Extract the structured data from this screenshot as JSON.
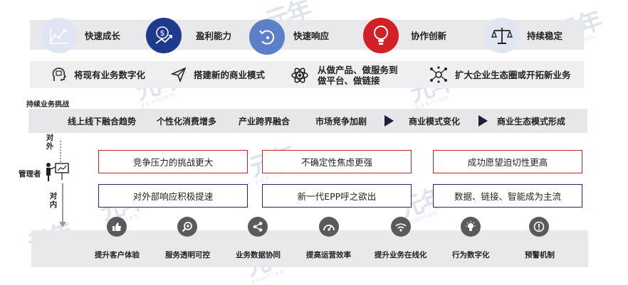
{
  "row1": [
    {
      "label": "快速成长",
      "icon": "growth-chart-icon"
    },
    {
      "label": "盈利能力",
      "icon": "money-growth-icon"
    },
    {
      "label": "快速响应",
      "icon": "refresh-cycle-icon"
    },
    {
      "label": "协作创新",
      "icon": "lightbulb-icon"
    },
    {
      "label": "持续稳定",
      "icon": "balance-scale-icon"
    }
  ],
  "row2": [
    {
      "label": "将现有业务数字化",
      "icon": "brain-head-icon"
    },
    {
      "label": "搭建新的商业模式",
      "icon": "paper-plane-icon"
    },
    {
      "label_line1": "从做产品、做服务到",
      "label_line2": "做平台、做链接",
      "icon": "atom-icon"
    },
    {
      "label": "扩大企业生态圈或开拓新业务",
      "icon": "network-nodes-icon"
    }
  ],
  "challenge_title": "持续业务挑战",
  "row3": [
    "线上线下融合趋势",
    "个性化消费增多",
    "产业跨界融合",
    "市场竞争加剧",
    "商业模式变化",
    "商业生态模式形成"
  ],
  "side": {
    "outer": "对外",
    "manager": "管理者",
    "inner": "对内"
  },
  "outer_boxes": [
    "竞争压力的挑战更大",
    "不确定性焦虑更强",
    "成功愿望迫切性更高"
  ],
  "inner_boxes": [
    "对外部响应积极提速",
    "新一代EPP呼之欲出",
    "数据、链接、智能成为主流"
  ],
  "row5": [
    {
      "label": "提升客户体验",
      "icon": "thumbs-up-icon"
    },
    {
      "label": "服务透明可控",
      "icon": "magnifier-plus-icon"
    },
    {
      "label": "业务数据协同",
      "icon": "share-nodes-icon"
    },
    {
      "label": "提高运营效率",
      "icon": "speedometer-icon"
    },
    {
      "label": "提升业务在线化",
      "icon": "wifi-signal-icon"
    },
    {
      "label": "行为数字化",
      "icon": "idea-bulb-icon"
    },
    {
      "label": "预警机制",
      "icon": "alert-icon"
    }
  ],
  "watermark": {
    "text": "元年",
    "sub": "yuanian"
  },
  "colors": {
    "red": "#c8202a",
    "navy": "#1e2a6e",
    "band": "#e9e9ec"
  }
}
